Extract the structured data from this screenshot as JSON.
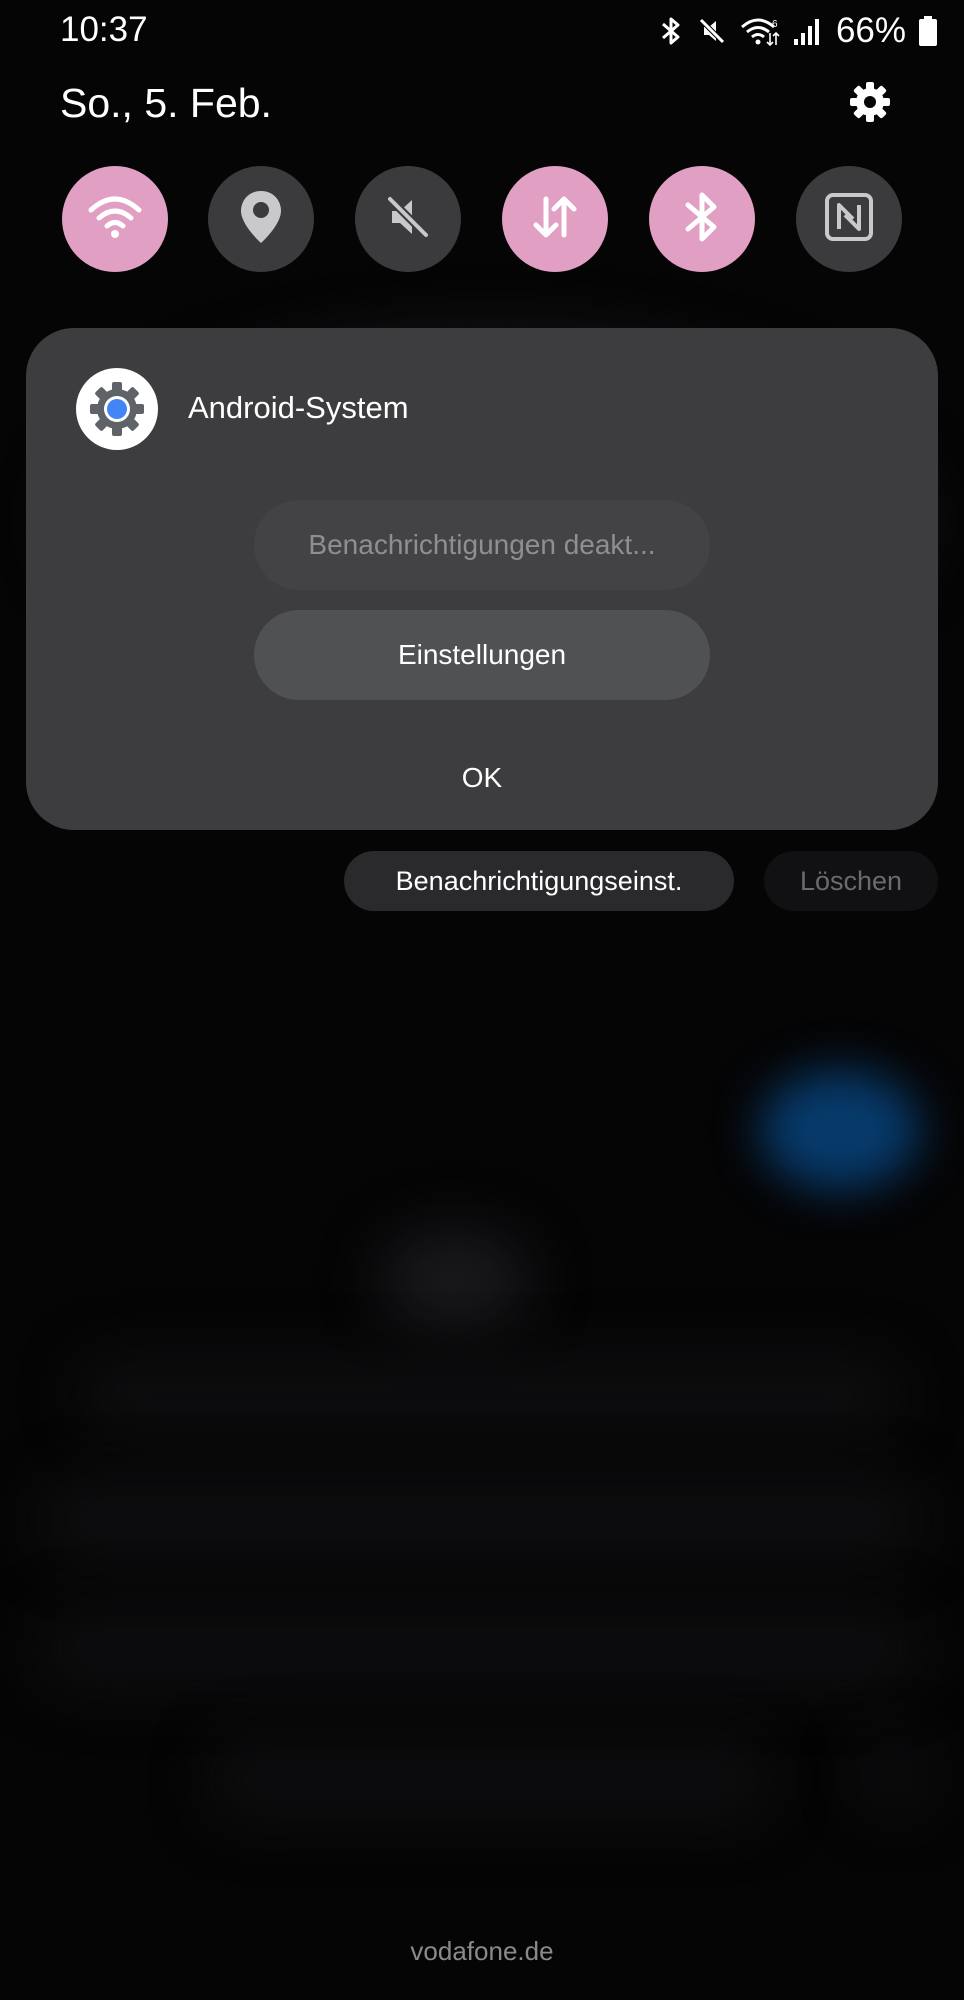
{
  "status_bar": {
    "time": "10:37",
    "battery_percent": "66%",
    "icons": [
      "bluetooth-icon",
      "mute-icon",
      "wifi-6-icon",
      "signal-icon",
      "battery-icon"
    ]
  },
  "header": {
    "date": "So., 5. Feb.",
    "settings_icon": "gear-icon"
  },
  "quick_settings": [
    {
      "name": "wifi",
      "icon": "wifi-icon",
      "active": true
    },
    {
      "name": "location",
      "icon": "location-pin-icon",
      "active": false
    },
    {
      "name": "sound",
      "icon": "mute-icon",
      "active": false
    },
    {
      "name": "mobile-data",
      "icon": "data-transfer-icon",
      "active": true
    },
    {
      "name": "bluetooth",
      "icon": "bluetooth-icon",
      "active": true
    },
    {
      "name": "nfc",
      "icon": "nfc-icon",
      "active": false
    }
  ],
  "notification": {
    "app_name": "Android-System",
    "disable_label": "Benachrichtigungen deakt...",
    "settings_label": "Einstellungen",
    "ok_label": "OK"
  },
  "actions": {
    "notification_settings": "Benachrichtigungseinst.",
    "clear": "Löschen"
  },
  "footer": {
    "carrier": "vodafone.de"
  },
  "colors": {
    "accent_pink": "#e09fc3",
    "tile_off": "#3b3b3d",
    "card_bg": "#3d3d3f",
    "app_icon_blue": "#4285f4"
  }
}
